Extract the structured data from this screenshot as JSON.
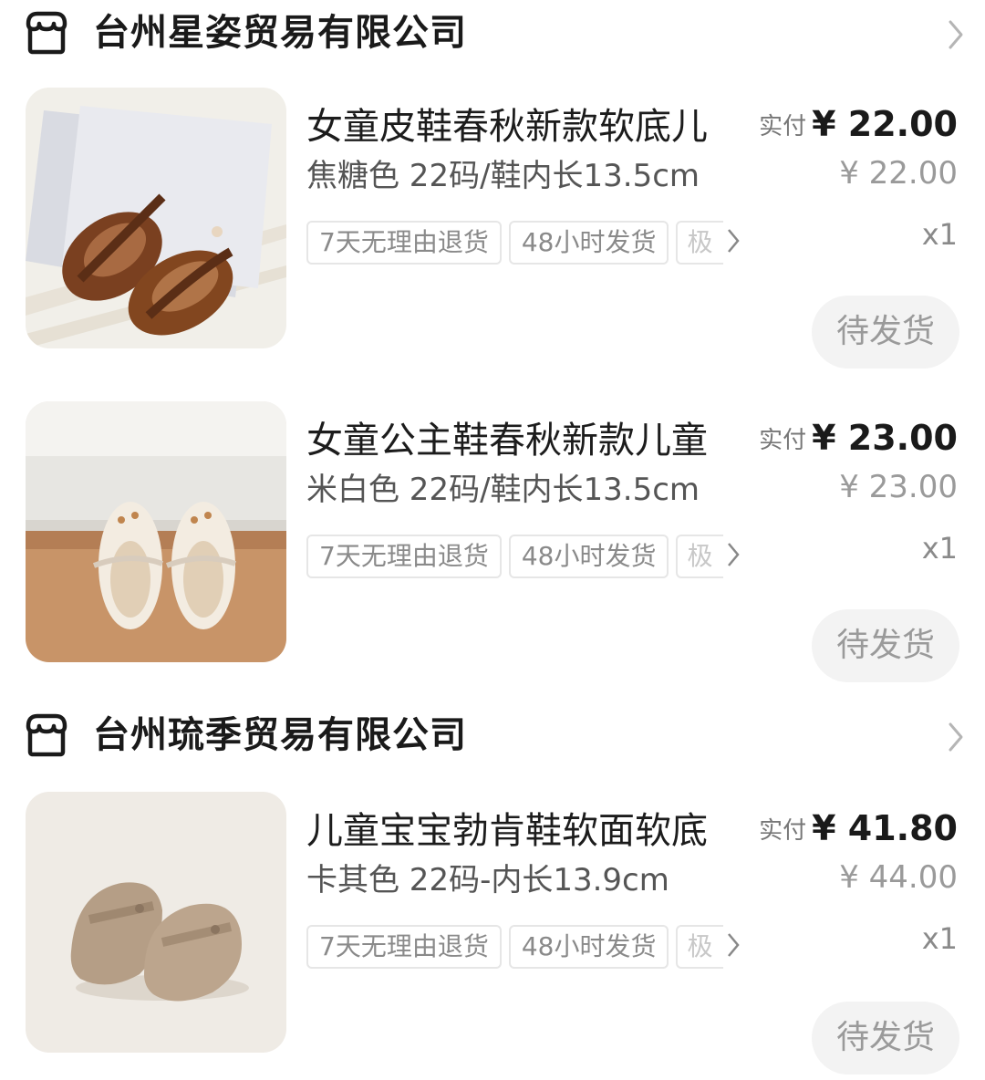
{
  "shops": [
    {
      "name": "台州星姿贸易有限公司",
      "items": [
        {
          "title": "女童皮鞋春秋新款软底儿",
          "spec": "焦糖色 22码/鞋内长13.5cm",
          "tags": [
            "7天无理由退货",
            "48小时发货",
            "极"
          ],
          "paid_label": "实付",
          "paid_price": "¥ 22.00",
          "original_price": "¥ 22.00",
          "quantity": "x1",
          "status": "待发货"
        },
        {
          "title": "女童公主鞋春秋新款儿童",
          "spec": "米白色 22码/鞋内长13.5cm",
          "tags": [
            "7天无理由退货",
            "48小时发货",
            "极"
          ],
          "paid_label": "实付",
          "paid_price": "¥ 23.00",
          "original_price": "¥ 23.00",
          "quantity": "x1",
          "status": "待发货"
        }
      ]
    },
    {
      "name": "台州琉季贸易有限公司",
      "items": [
        {
          "title": "儿童宝宝勃肯鞋软面软底",
          "spec": "卡其色 22码-内长13.9cm",
          "tags": [
            "7天无理由退货",
            "48小时发货",
            "极"
          ],
          "paid_label": "实付",
          "paid_price": "¥ 41.80",
          "original_price": "¥ 44.00",
          "quantity": "x1",
          "status": "待发货"
        }
      ]
    }
  ],
  "icons": {
    "shop": "store-icon",
    "chevron": "chevron-right-icon",
    "tags_more": "chevron-right-icon"
  },
  "colors": {
    "background": "#ffffff",
    "status_button_bg": "#f3f3f3",
    "thumb_1_bg": "#f1efe9",
    "thumb_2_bg": "#ece8e1",
    "thumb_3_bg": "#efebe5"
  }
}
